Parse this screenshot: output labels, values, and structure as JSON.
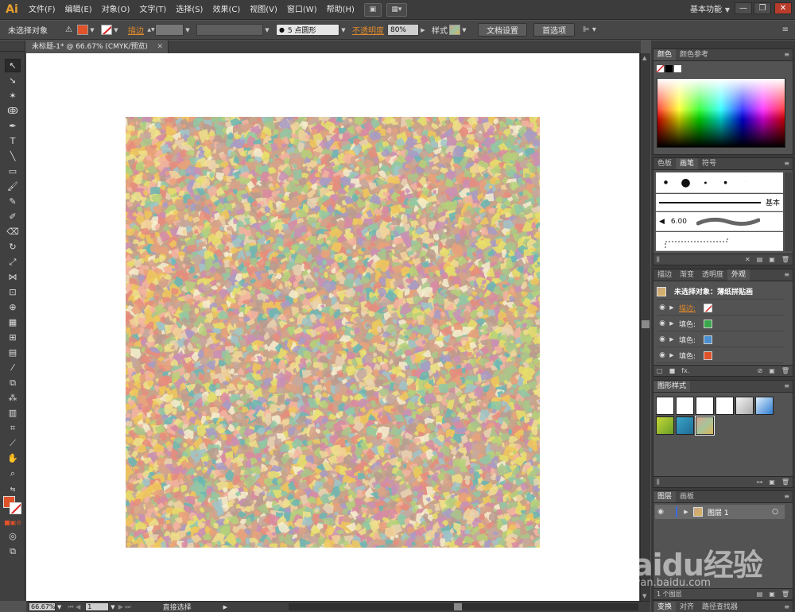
{
  "app": {
    "logo": "Ai"
  },
  "menu": {
    "items": [
      "文件(F)",
      "编辑(E)",
      "对象(O)",
      "文字(T)",
      "选择(S)",
      "效果(C)",
      "视图(V)",
      "窗口(W)",
      "帮助(H)"
    ],
    "workspace": "基本功能"
  },
  "control": {
    "selection_status": "未选择对象",
    "stroke_label": "描边",
    "brush_value": "5 点圆形",
    "opacity_label": "不透明度",
    "opacity_value": "80%",
    "style_label": "样式",
    "doc_settings_button": "文档设置",
    "preferences_button": "首选项",
    "fill_color": "#e0522a"
  },
  "document": {
    "tab_title": "未标题-1* @ 66.67% (CMYK/预览)"
  },
  "status": {
    "zoom": "66.67%",
    "artboard": "1",
    "tool": "直接选择"
  },
  "panels": {
    "color": {
      "tabs": [
        "颜色",
        "颜色参考"
      ]
    },
    "brushes": {
      "tabs": [
        "色板",
        "画笔",
        "符号"
      ],
      "basic_label": "基本",
      "size_label": "6.00"
    },
    "appearance": {
      "tabs": [
        "描边",
        "渐变",
        "透明度",
        "外观"
      ],
      "header": "未选择对象：薄纸拼贴画",
      "rows": [
        {
          "label": "描边:",
          "chip": "none"
        },
        {
          "label": "填色:",
          "chip": "#3aa74a"
        },
        {
          "label": "填色:",
          "chip": "#4b8fd1"
        },
        {
          "label": "填色:",
          "chip": "#e0522a"
        }
      ]
    },
    "graphic_styles": {
      "tabs": [
        "图形样式"
      ]
    },
    "layers": {
      "tabs": [
        "图层",
        "画板"
      ],
      "layer_name": "图层 1",
      "footer": "1 个图层"
    },
    "bottom": {
      "tabs": [
        "变换",
        "对齐",
        "路径查找器"
      ]
    }
  },
  "watermark": {
    "brand": "Baidu经验",
    "url": "jingyan.baidu.com"
  }
}
